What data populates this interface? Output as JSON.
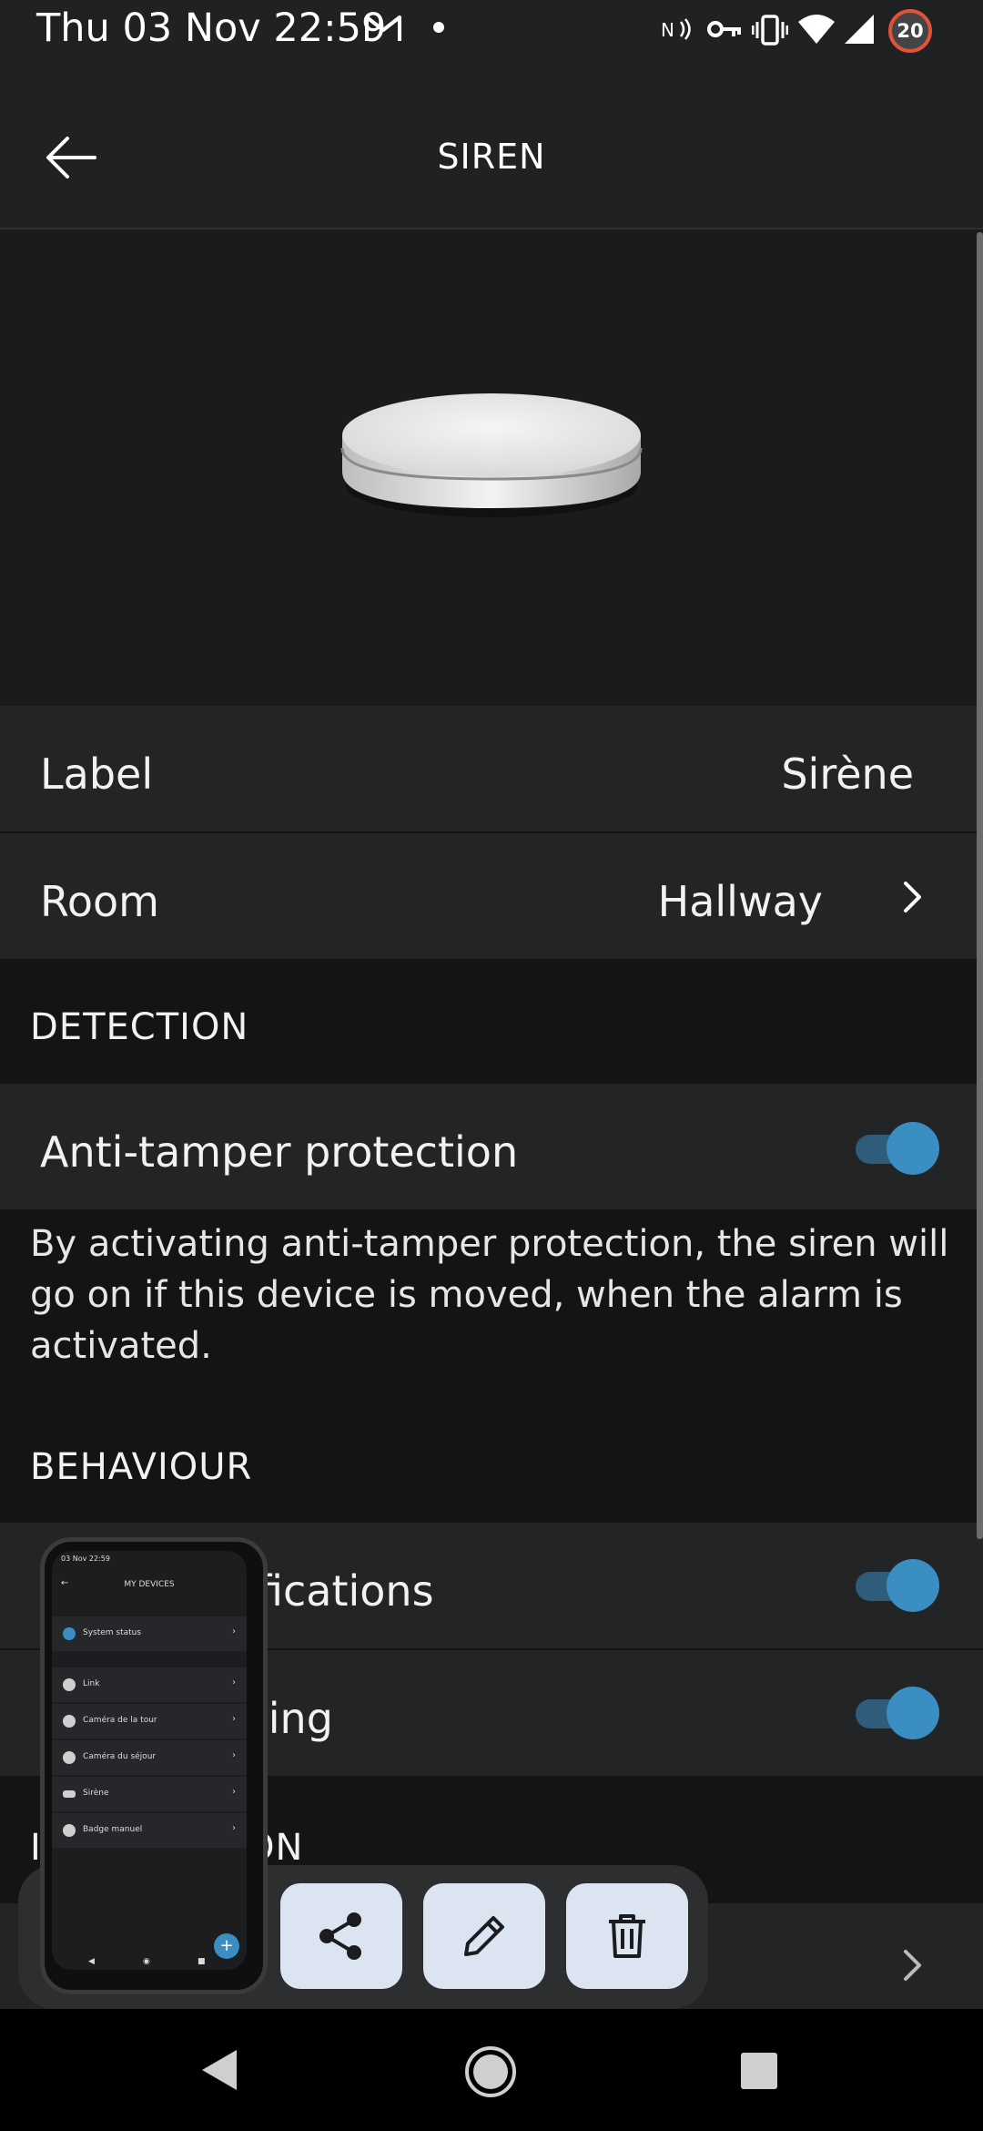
{
  "status_bar": {
    "time": "Thu 03 Nov 22:59",
    "battery_level": "20",
    "icons": [
      "gmail-icon",
      "dot-icon",
      "nfc-icon",
      "vpn-key-icon",
      "vibrate-icon",
      "wifi-icon",
      "signal-icon",
      "battery-icon"
    ]
  },
  "app_bar": {
    "title": "SIREN",
    "back_icon": "arrow-left-icon"
  },
  "device": {
    "image": "siren-device-image"
  },
  "settings": {
    "label": {
      "title": "Label",
      "value": "Sirène"
    },
    "room": {
      "title": "Room",
      "value": "Hallway"
    }
  },
  "detection": {
    "section_title": "DETECTION",
    "anti_tamper": {
      "title": "Anti-tamper protection",
      "enabled": true
    },
    "description_line1": "By activating anti-tamper protection, the siren will",
    "description_line2": "go on if this device is moved, when the alarm is",
    "description_line3": "activated."
  },
  "behaviour": {
    "section_title": "BEHAVIOUR",
    "row1_visible_text": "fications",
    "row1_enabled": true,
    "row2_visible_text": "ling",
    "row2_enabled": true,
    "next_section_partial_left": "I",
    "next_section_partial_right": "ON"
  },
  "action_bar": {
    "buttons": [
      "share-icon",
      "edit-pencil-icon",
      "delete-trash-icon"
    ]
  },
  "mini_screenshot": {
    "status_time": "03 Nov 22:59",
    "title": "MY DEVICES",
    "items": [
      "System status",
      "Link",
      "Caméra de la tour",
      "Caméra du séjour",
      "Sirène",
      "Badge manuel"
    ],
    "fab": "+"
  },
  "colors": {
    "background": "#131416",
    "row": "#232426",
    "accent_toggle": "#3b8ec2",
    "action_button": "#dbe4f0"
  }
}
